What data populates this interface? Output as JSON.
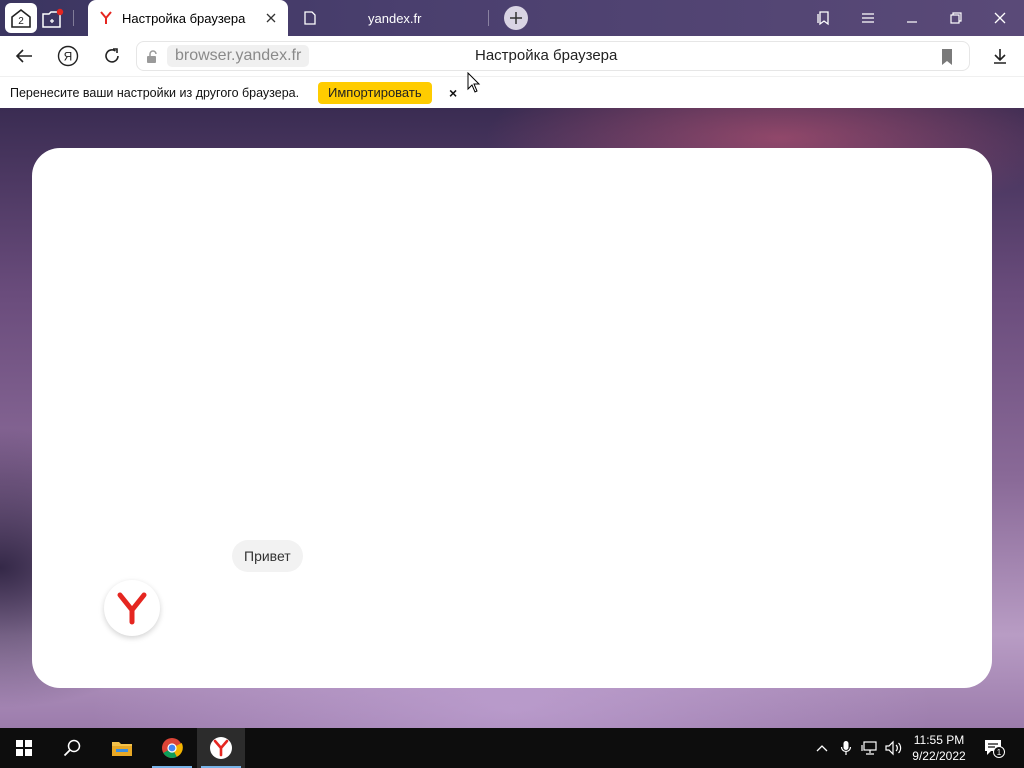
{
  "tabstrip": {
    "home_tab_count": "2",
    "active_tab": {
      "title": "Настройка браузера",
      "favicon": "yandex-y-icon"
    },
    "inactive_tab": {
      "title": "yandex.fr",
      "favicon": "page-icon"
    },
    "accent_notification_color": "#e52620"
  },
  "window_controls": [
    "collections-icon",
    "menu-icon",
    "minimize-icon",
    "restore-icon",
    "close-icon"
  ],
  "navbar": {
    "url": "browser.yandex.fr",
    "page_title": "Настройка браузера"
  },
  "infobar": {
    "message": "Перенесите ваши настройки из другого браузера.",
    "import_label": "Импортировать",
    "close_glyph": "×",
    "import_color": "#ffcc00"
  },
  "content": {
    "chat_message": "Привет",
    "assistant_icon": "yandex-y-logo"
  },
  "taskbar": {
    "apps": [
      "start-icon",
      "search-icon",
      "file-explorer-icon",
      "chrome-icon",
      "yandex-browser-icon"
    ],
    "time": "11:55 PM",
    "date": "9/22/2022",
    "notification_count": "1"
  }
}
